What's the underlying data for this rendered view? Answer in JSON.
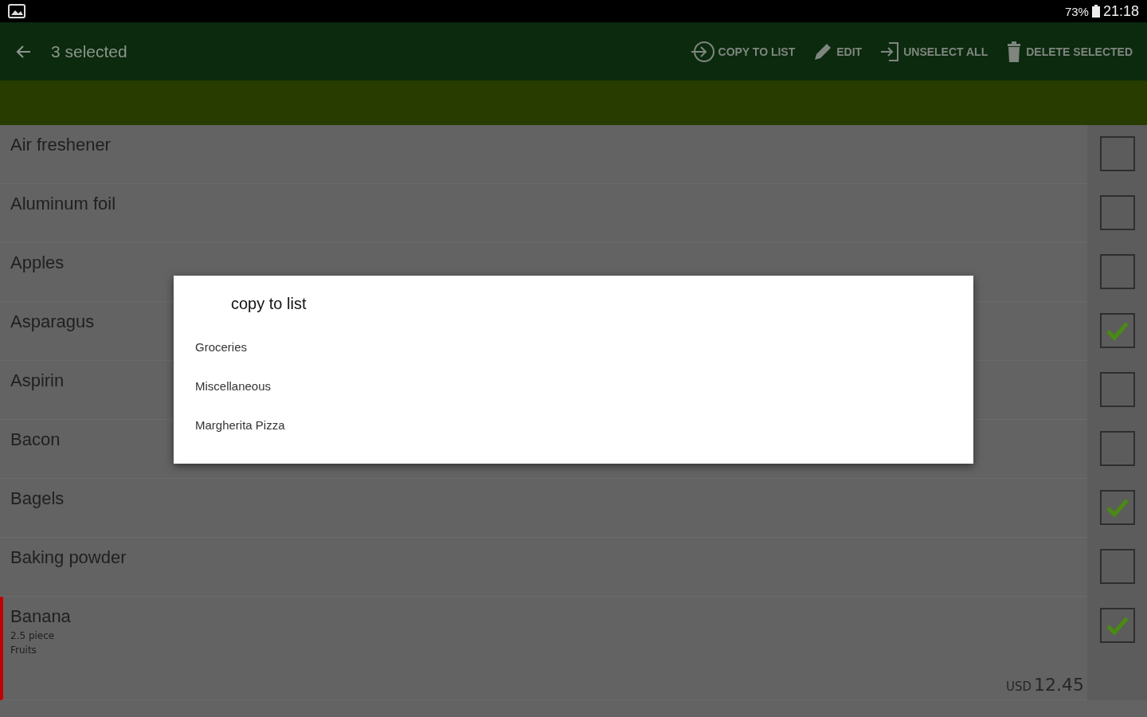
{
  "status_bar": {
    "battery": "73%",
    "time": "21:18"
  },
  "action_bar": {
    "title": "3 selected",
    "actions": [
      {
        "kind": "copy",
        "label": "COPY TO LIST"
      },
      {
        "kind": "edit",
        "label": "EDIT"
      },
      {
        "kind": "unselect",
        "label": "UNSELECT ALL"
      },
      {
        "kind": "delete",
        "label": "DELETE SELECTED"
      }
    ]
  },
  "items": [
    {
      "name": "Air freshener",
      "checked": false
    },
    {
      "name": "Aluminum foil",
      "checked": false
    },
    {
      "name": "Apples",
      "checked": false
    },
    {
      "name": "Asparagus",
      "checked": true
    },
    {
      "name": "Aspirin",
      "checked": false
    },
    {
      "name": "Bacon",
      "checked": false
    },
    {
      "name": "Bagels",
      "checked": true
    },
    {
      "name": "Baking powder",
      "checked": false
    },
    {
      "name": "Banana",
      "checked": true,
      "color": "#c00000",
      "quantity": "2.5 piece",
      "category": "Fruits",
      "currency": "USD",
      "price": "12.45"
    }
  ],
  "dialog": {
    "title": "copy to list",
    "options": [
      "Groceries",
      "Miscellaneous",
      "Margherita Pizza"
    ]
  }
}
